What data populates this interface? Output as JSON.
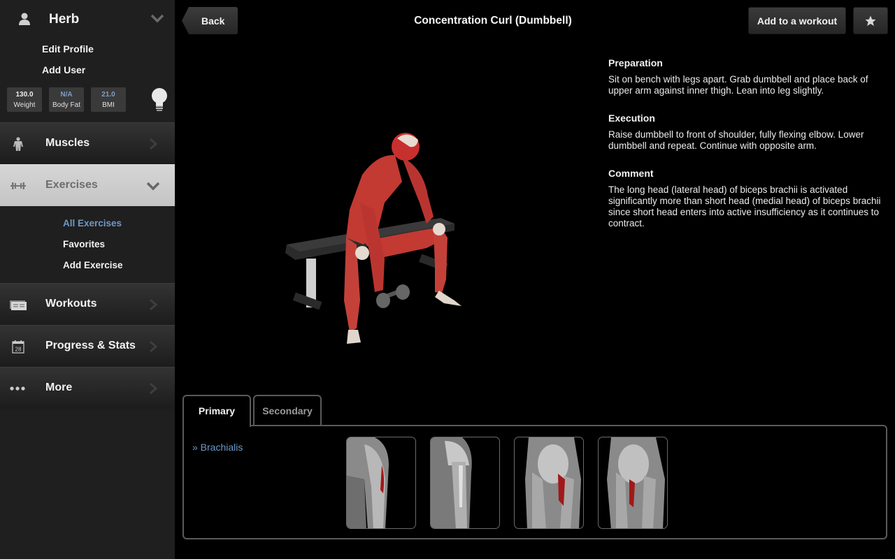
{
  "sidebar": {
    "profile": {
      "name": "Herb",
      "links": [
        "Edit Profile",
        "Add User"
      ],
      "stats": [
        {
          "value": "130.0",
          "label": "Weight"
        },
        {
          "value": "N/A",
          "label": "Body Fat"
        },
        {
          "value": "21.0",
          "label": "BMI"
        }
      ]
    },
    "nav": [
      {
        "label": "Muscles",
        "icon": "body-icon"
      },
      {
        "label": "Exercises",
        "icon": "dumbbell-icon",
        "expanded": true
      },
      {
        "label": "Workouts",
        "icon": "workouts-icon"
      },
      {
        "label": "Progress & Stats",
        "icon": "calendar-icon",
        "icon_text": "28"
      },
      {
        "label": "More",
        "icon": "more-dots-icon"
      }
    ],
    "exercise_sub": [
      {
        "label": "All Exercises",
        "selected": true
      },
      {
        "label": "Favorites"
      },
      {
        "label": "Add Exercise"
      }
    ]
  },
  "header": {
    "back_label": "Back",
    "title": "Concentration Curl (Dumbbell)",
    "add_label": "Add to a workout",
    "favorite_icon": "star-icon"
  },
  "details": {
    "sections": [
      {
        "heading": "Preparation",
        "text": "Sit on bench with legs apart. Grab dumbbell and place back of upper arm against inner thigh. Lean into leg slightly."
      },
      {
        "heading": "Execution",
        "text": "Raise dumbbell to front of shoulder, fully flexing elbow. Lower dumbbell and repeat. Continue with opposite arm."
      },
      {
        "heading": "Comment",
        "text": "The long head (lateral head) of biceps brachii is activated significantly more than short head (medial head) of biceps brachii since short head enters into active insufficiency as it continues to contract."
      }
    ]
  },
  "muscles": {
    "tabs": [
      {
        "label": "Primary",
        "active": true
      },
      {
        "label": "Secondary",
        "active": false
      }
    ],
    "primary": [
      {
        "label": "» Brachialis"
      }
    ],
    "thumbnails": [
      "arm-front-highlighted",
      "arm-side",
      "arm-back-highlighted",
      "arm-back-alt-highlighted"
    ]
  },
  "colors": {
    "accent_blue": "#6f98c7",
    "highlight_muscle": "#a11818"
  }
}
